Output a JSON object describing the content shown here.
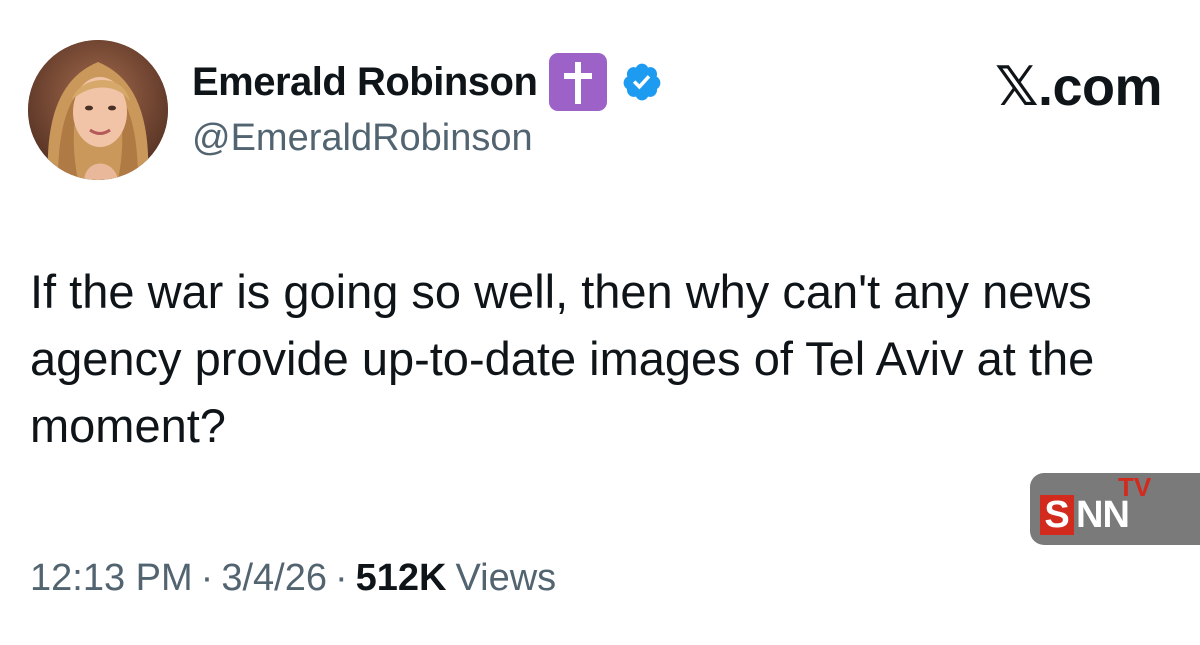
{
  "author": {
    "display_name": "Emerald Robinson",
    "handle": "@EmeraldRobinson",
    "badges": {
      "emoji_badge_icon": "latin-cross-icon",
      "emoji_badge_color": "#9d62c7",
      "verified_icon": "verified-check-icon",
      "verified_color": "#1d9bf0"
    },
    "avatar_icon": "profile-photo"
  },
  "site_label": "𝕏.com",
  "tweet": {
    "text": "If the war is going so well, then why can't any news agency provide up-to-date images of Tel Aviv at the moment?"
  },
  "meta": {
    "time": "12:13 PM",
    "separator": "·",
    "date": "3/4/26",
    "views_count": "512K",
    "views_label": "Views"
  },
  "watermark": {
    "s_letter": "S",
    "nn_letters": "NN",
    "tv_label": "TV",
    "accent_color": "#d32a1e"
  }
}
